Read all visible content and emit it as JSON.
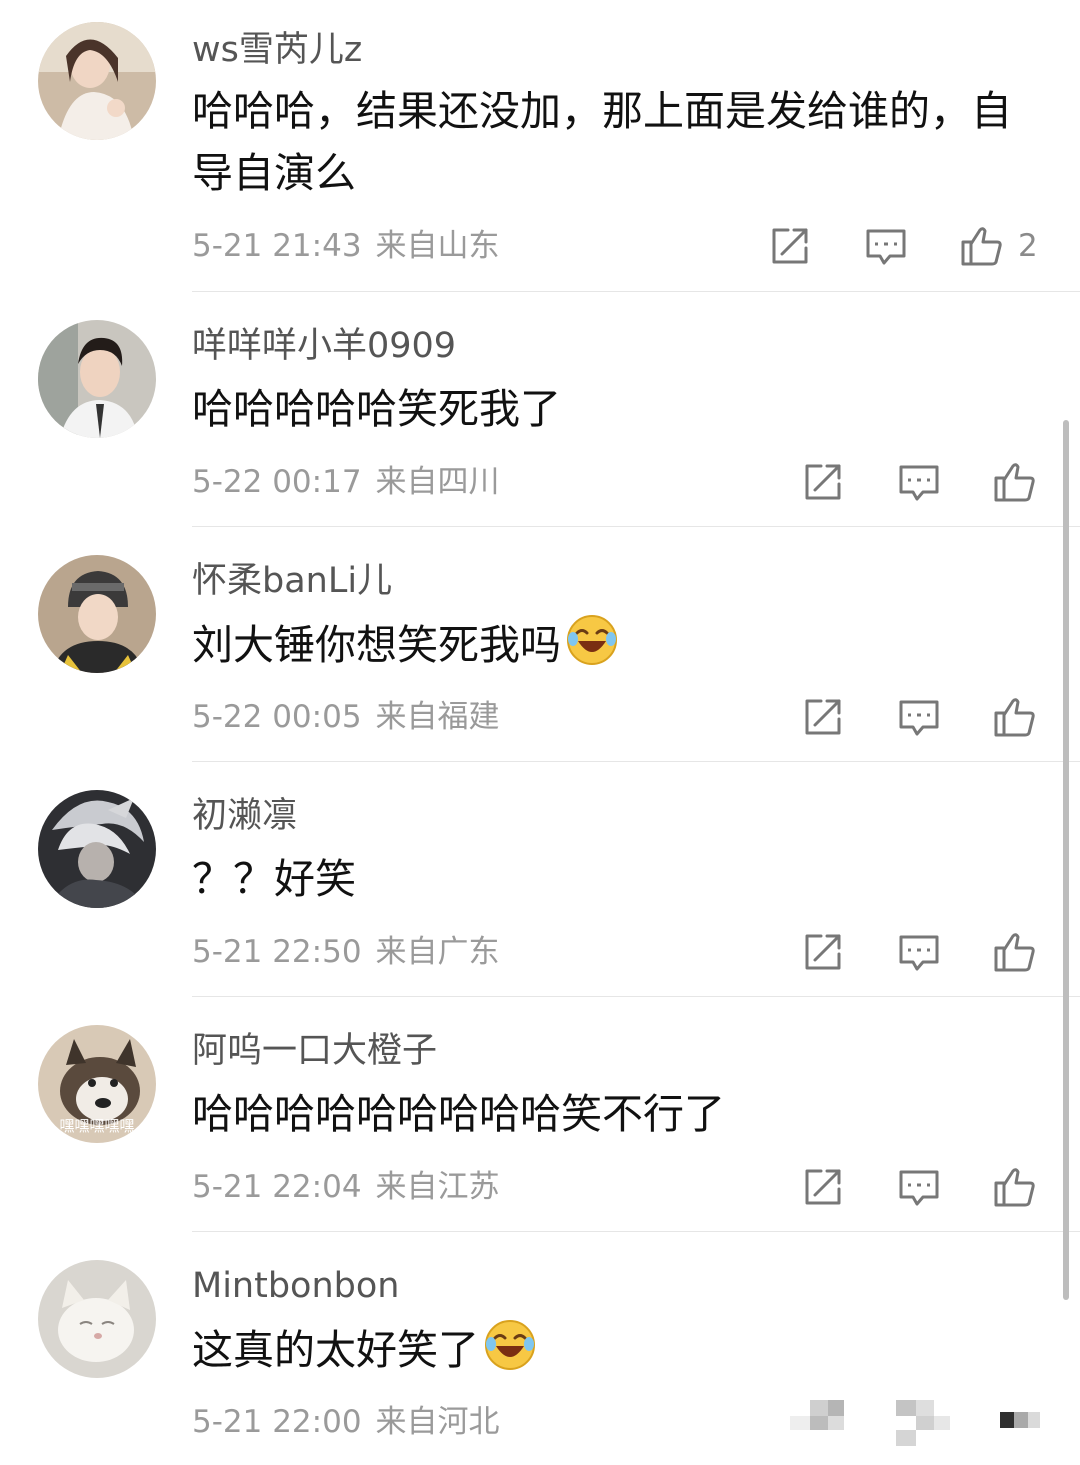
{
  "comments": [
    {
      "username": "ws雪芮儿z",
      "text": "哈哈哈，结果还没加，那上面是发给谁的，自导自演么",
      "time": "5-21 21:43",
      "location": "来自山东",
      "likes": "2",
      "avatar_icon": "girl-avatar-photo"
    },
    {
      "username": "咩咩咩小羊0909",
      "text": "哈哈哈哈哈笑死我了",
      "time": "5-22 00:17",
      "location": "来自四川",
      "likes": "",
      "avatar_icon": "man-avatar-photo"
    },
    {
      "username": "怀柔banLi儿",
      "text": "刘大锤你想笑死我吗",
      "emoji": "laugh-cry-emoji",
      "time": "5-22 00:05",
      "location": "来自福建",
      "likes": "",
      "avatar_icon": "helmet-girl-avatar-photo"
    },
    {
      "username": "初濑凛",
      "text": "？？好笑",
      "time": "5-21 22:50",
      "location": "来自广东",
      "likes": "",
      "avatar_icon": "anime-avatar"
    },
    {
      "username": "阿呜一口大橙子",
      "text": "哈哈哈哈哈哈哈哈哈笑不行了",
      "time": "5-21 22:04",
      "location": "来自江苏",
      "likes": "",
      "avatar_icon": "husky-dog-avatar",
      "avatar_caption": "嘿嘿嘿嘿嘿"
    },
    {
      "username": "Mintbonbon",
      "text": "这真的太好笑了",
      "emoji": "laugh-cry-emoji",
      "time": "5-21 22:00",
      "location": "来自河北",
      "likes": "",
      "avatar_icon": "white-cat-avatar"
    }
  ],
  "icons": {
    "share": "share-icon",
    "reply": "comment-icon",
    "like": "thumbs-up-icon"
  },
  "colors": {
    "username": "#555555",
    "text": "#111111",
    "meta": "#9a9a9a",
    "icon": "#777777",
    "divider": "#e6e6e6"
  }
}
